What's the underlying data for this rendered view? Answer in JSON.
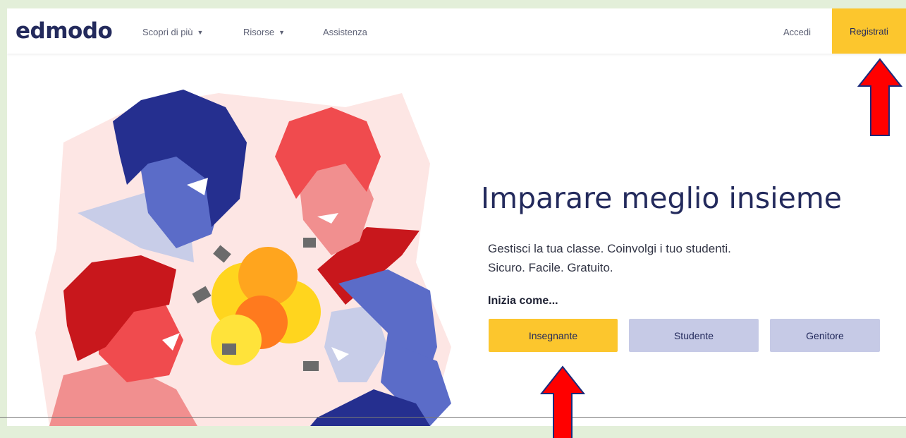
{
  "nav": {
    "logo": "edmodo",
    "links": [
      {
        "label": "Scopri di più",
        "has_dropdown": true
      },
      {
        "label": "Risorse",
        "has_dropdown": true
      },
      {
        "label": "Assistenza",
        "has_dropdown": false
      }
    ],
    "signin_label": "Accedi",
    "register_label": "Registrati"
  },
  "hero": {
    "headline": "Imparare meglio insieme",
    "subtext_line1": "Gestisci la tua classe. Coinvolgi i tuo studenti.",
    "subtext_line2": "Sicuro. Facile. Gratuito.",
    "start_label": "Inizia come...",
    "roles": [
      "Insegnante",
      "Studente",
      "Genitore"
    ]
  },
  "colors": {
    "accent_yellow": "#fcc62d",
    "secondary_lavender": "#c6cae6",
    "brand_navy": "#232a5c",
    "annotation_arrow": "#ff0000"
  },
  "icons": {
    "dropdown": "chevron-down-icon",
    "annotation": "red-arrow-icon"
  }
}
